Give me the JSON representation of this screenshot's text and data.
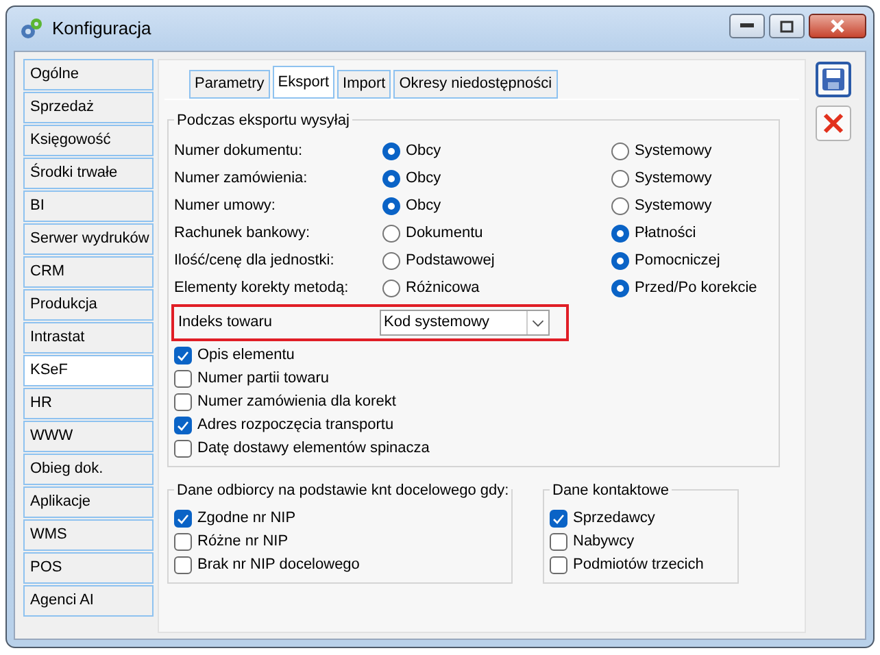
{
  "window": {
    "title": "Konfiguracja"
  },
  "sidebar": {
    "items": [
      {
        "label": "Ogólne",
        "selected": false
      },
      {
        "label": "Sprzedaż",
        "selected": false
      },
      {
        "label": "Księgowość",
        "selected": false
      },
      {
        "label": "Środki trwałe",
        "selected": false
      },
      {
        "label": "BI",
        "selected": false
      },
      {
        "label": "Serwer wydruków",
        "selected": false
      },
      {
        "label": "CRM",
        "selected": false
      },
      {
        "label": "Produkcja",
        "selected": false
      },
      {
        "label": "Intrastat",
        "selected": false
      },
      {
        "label": "KSeF",
        "selected": true
      },
      {
        "label": "HR",
        "selected": false
      },
      {
        "label": "WWW",
        "selected": false
      },
      {
        "label": "Obieg dok.",
        "selected": false
      },
      {
        "label": "Aplikacje",
        "selected": false
      },
      {
        "label": "WMS",
        "selected": false
      },
      {
        "label": "POS",
        "selected": false
      },
      {
        "label": "Agenci AI",
        "selected": false
      }
    ]
  },
  "tabs": [
    {
      "label": "Parametry",
      "selected": false
    },
    {
      "label": "Eksport",
      "selected": true
    },
    {
      "label": "Import",
      "selected": false
    },
    {
      "label": "Okresy niedostępności",
      "selected": false
    }
  ],
  "export_group": {
    "title": "Podczas eksportu wysyłaj",
    "rows": [
      {
        "label": "Numer dokumentu:",
        "options": [
          {
            "label": "Obcy",
            "selected": true
          },
          {
            "label": "Systemowy",
            "selected": false
          }
        ]
      },
      {
        "label": "Numer zamówienia:",
        "options": [
          {
            "label": "Obcy",
            "selected": true
          },
          {
            "label": "Systemowy",
            "selected": false
          }
        ]
      },
      {
        "label": "Numer umowy:",
        "options": [
          {
            "label": "Obcy",
            "selected": true
          },
          {
            "label": "Systemowy",
            "selected": false
          }
        ]
      },
      {
        "label": "Rachunek bankowy:",
        "options": [
          {
            "label": "Dokumentu",
            "selected": false
          },
          {
            "label": "Płatności",
            "selected": true
          }
        ]
      },
      {
        "label": "Ilość/cenę dla jednostki:",
        "options": [
          {
            "label": "Podstawowej",
            "selected": false
          },
          {
            "label": "Pomocniczej",
            "selected": true
          }
        ]
      },
      {
        "label": "Elementy korekty metodą:",
        "options": [
          {
            "label": "Różnicowa",
            "selected": false
          },
          {
            "label": "Przed/Po korekcie",
            "selected": true
          }
        ]
      }
    ],
    "index_field": {
      "label": "Indeks towaru",
      "value": "Kod systemowy",
      "highlighted": true
    },
    "checkboxes": [
      {
        "label": "Opis elementu",
        "checked": true
      },
      {
        "label": "Numer partii towaru",
        "checked": false
      },
      {
        "label": "Numer zamówienia dla korekt",
        "checked": false
      },
      {
        "label": "Adres rozpoczęcia transportu",
        "checked": true
      },
      {
        "label": "Datę dostawy elementów spinacza",
        "checked": false
      }
    ]
  },
  "recipient_group": {
    "title": "Dane odbiorcy na podstawie knt docelowego gdy:",
    "checkboxes": [
      {
        "label": "Zgodne nr NIP",
        "checked": true
      },
      {
        "label": "Różne nr NIP",
        "checked": false
      },
      {
        "label": "Brak nr NIP docelowego",
        "checked": false
      }
    ]
  },
  "contact_group": {
    "title": "Dane kontaktowe",
    "checkboxes": [
      {
        "label": "Sprzedawcy",
        "checked": true
      },
      {
        "label": "Nabywcy",
        "checked": false
      },
      {
        "label": "Podmiotów trzecich",
        "checked": false
      }
    ]
  }
}
